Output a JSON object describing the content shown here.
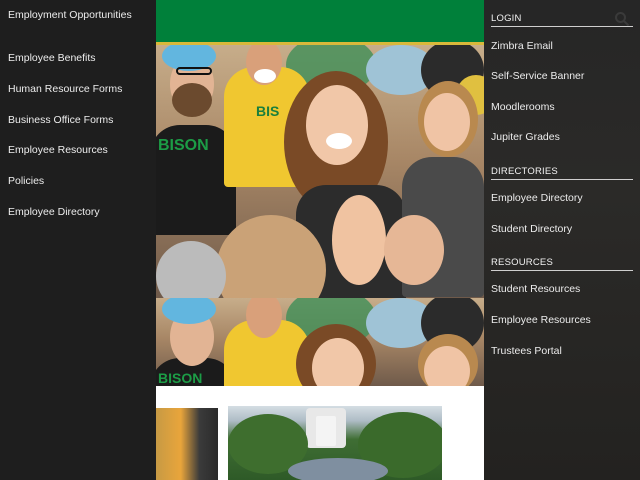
{
  "left_nav": {
    "items": [
      {
        "label": "Employment Opportunities"
      },
      {
        "label": "Employee Benefits"
      },
      {
        "label": "Human Resource Forms"
      },
      {
        "label": "Business Office Forms"
      },
      {
        "label": "Employee Resources"
      },
      {
        "label": "Policies"
      },
      {
        "label": "Employee Directory"
      }
    ]
  },
  "center": {
    "header_color": "#00803a",
    "accent_color": "#d9b83a",
    "shirt_text_1": "BISON",
    "shirt_text_2": "BIS",
    "shirt_text_3": "BISON"
  },
  "right_nav": {
    "login": {
      "heading": "LOGIN",
      "links": [
        "Zimbra Email",
        "Self-Service Banner",
        "Moodlerooms",
        "Jupiter Grades"
      ]
    },
    "directories": {
      "heading": "DIRECTORIES",
      "links": [
        "Employee Directory",
        "Student Directory"
      ]
    },
    "resources": {
      "heading": "RESOURCES",
      "links": [
        "Student Resources",
        "Employee Resources",
        "Trustees Portal"
      ]
    },
    "search_icon": "search-icon"
  }
}
